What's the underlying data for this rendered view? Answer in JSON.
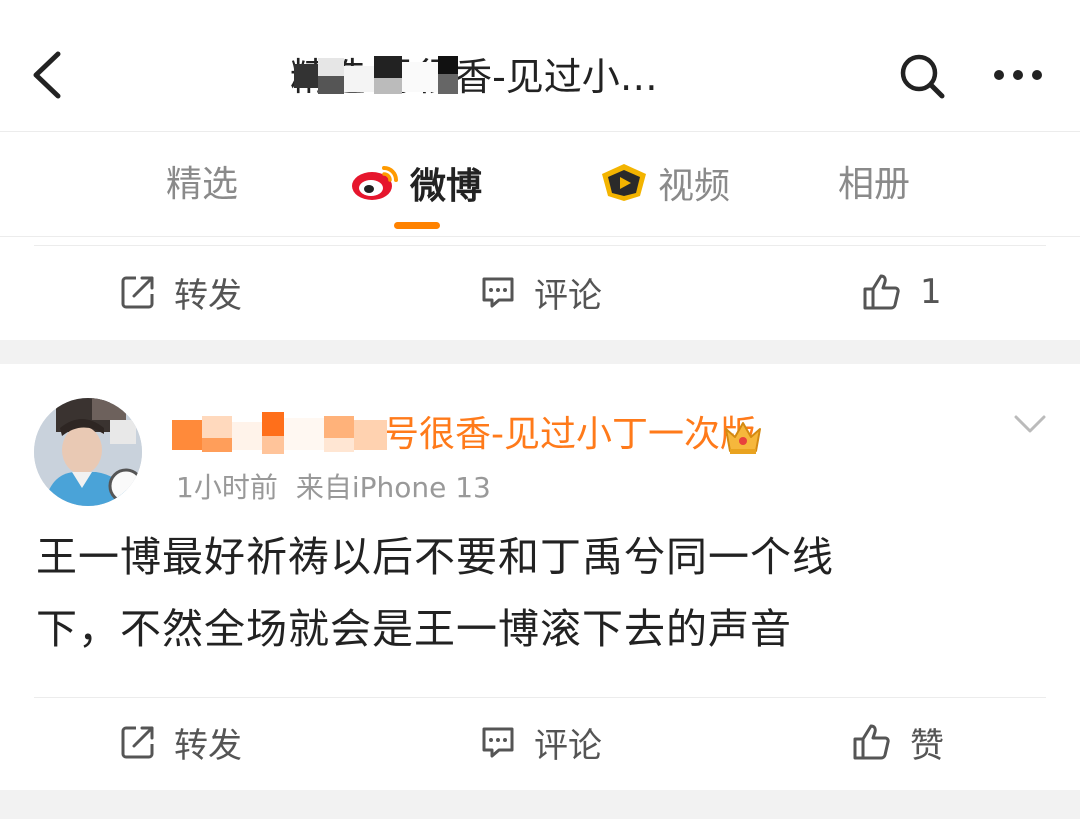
{
  "header": {
    "title": "精选 号很香-见过小…"
  },
  "tabs": [
    {
      "label": "精选",
      "icon": "",
      "active": false
    },
    {
      "label": "微博",
      "icon": "weibo-logo",
      "active": true
    },
    {
      "label": "视频",
      "icon": "video-badge",
      "active": false
    },
    {
      "label": "相册",
      "icon": "",
      "active": false
    }
  ],
  "prev_post": {
    "repost_label": "转发",
    "comment_label": "评论",
    "like_count": "1"
  },
  "post": {
    "username": "号很香-见过小丁一次版",
    "time": "1小时前",
    "source": "来自iPhone 13",
    "text_lines": [
      "王一博最好祈祷以后不要和丁禹兮同一个线",
      "下，不然全场就会是王一博滚下去的声音"
    ],
    "repost_label": "转发",
    "comment_label": "评论",
    "like_label": "赞"
  },
  "colors": {
    "accent": "#ff8200",
    "username": "#ff7a1a",
    "muted": "#999999"
  }
}
